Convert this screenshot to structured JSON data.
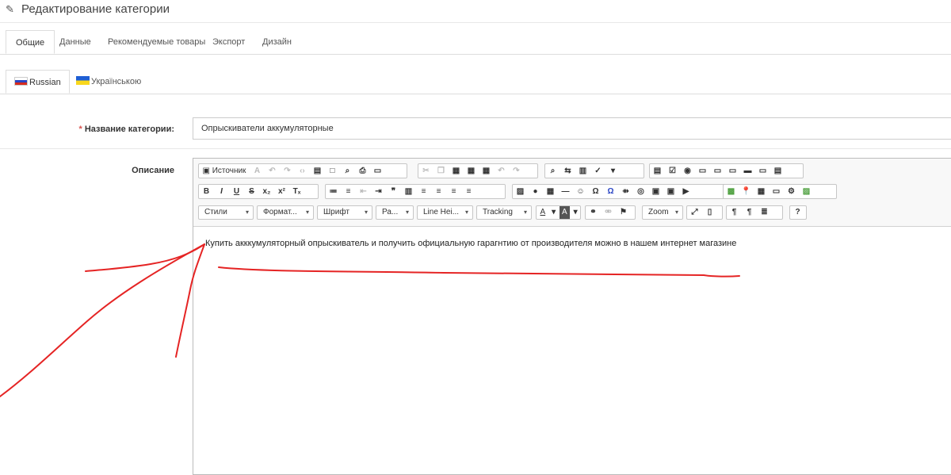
{
  "header": {
    "title": "Редактирование категории",
    "icon": "pencil-icon"
  },
  "main_tabs": [
    {
      "label": "Общие",
      "active": true
    },
    {
      "label": "Данные"
    },
    {
      "label": "Рекомендуемые товары"
    },
    {
      "label": "Экспорт"
    },
    {
      "label": "Дизайн"
    }
  ],
  "language_tabs": [
    {
      "label": "Russian",
      "flag": "russia-flag-icon",
      "active": true
    },
    {
      "label": "Українською",
      "flag": "ukraine-flag-icon"
    }
  ],
  "form": {
    "name_label": "Название категории:",
    "name_required_mark": "*",
    "name_value": "Опрыскиватели аккумуляторные",
    "description_label": "Описание"
  },
  "editor": {
    "source_label": "Источник",
    "combos": [
      "Стили",
      "Формат...",
      "Шрифт",
      "Ра...",
      "Line Hei...",
      "Tracking",
      "Zoom"
    ],
    "text_color_label": "A",
    "bg_color_label": "A",
    "help_label": "?",
    "content": "Купить акккумуляторный опрыскиватель и получить официальную гарагнтию от производителя можно в нашем интернет магазине"
  },
  "colors": {
    "accent_red": "#d9534f",
    "annotation_red": "#e52424"
  }
}
